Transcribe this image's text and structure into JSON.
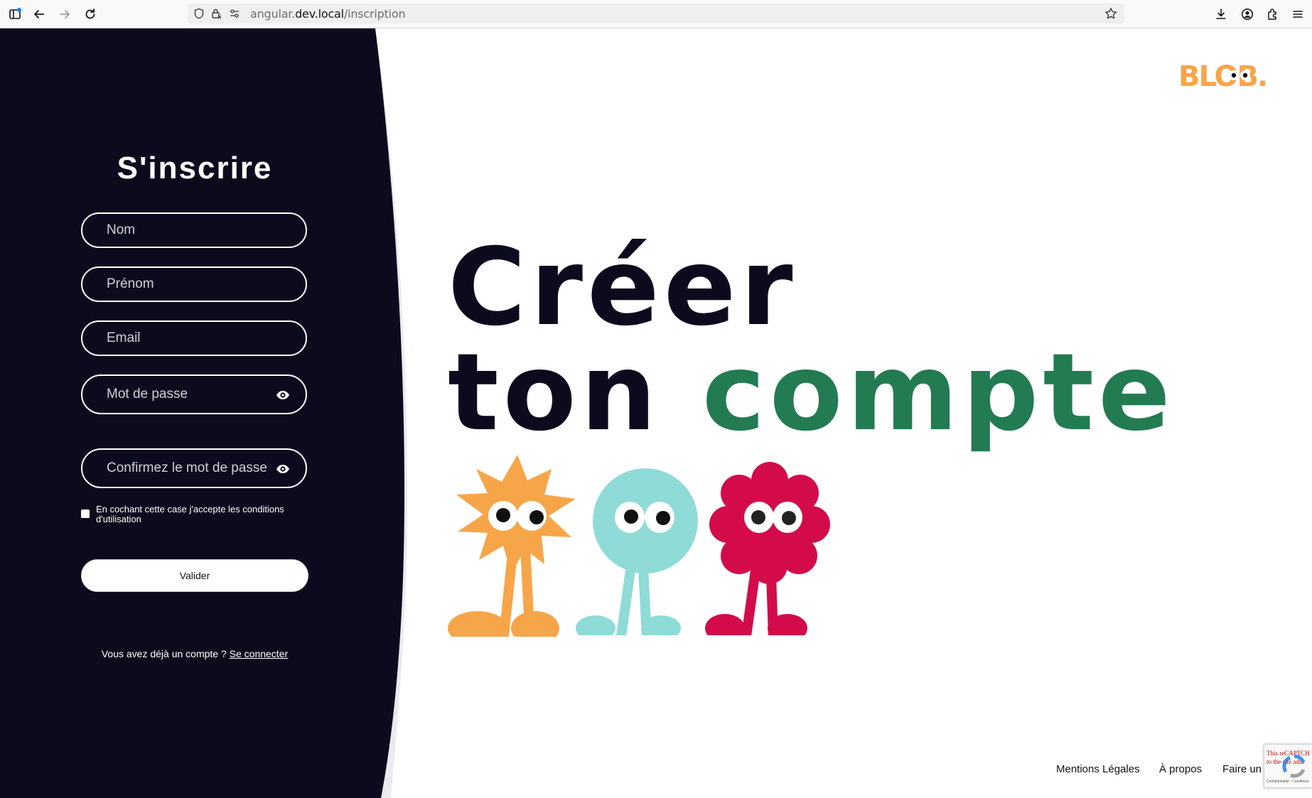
{
  "browser": {
    "url_prefix": "angular.",
    "url_host": "dev.local",
    "url_path": "/inscription"
  },
  "form": {
    "title": "S'inscrire",
    "nom_placeholder": "Nom",
    "prenom_placeholder": "Prénom",
    "email_placeholder": "Email",
    "password_placeholder": "Mot de passe",
    "confirm_placeholder": "Confirmez le mot de passe",
    "terms_text": "En cochant cette case j'accepte les conditions d'utilisation",
    "submit_label": "Valider",
    "login_prompt": "Vous avez déjà un compte ? ",
    "login_link": "Se connecter"
  },
  "hero": {
    "line1": "Créer",
    "line2_dark": "ton ",
    "line2_green": "compte"
  },
  "logo": {
    "text": "BLOB."
  },
  "footer": {
    "mentions": "Mentions Légales",
    "apropos": "À propos",
    "don": "Faire un D"
  },
  "recaptcha": {
    "warning_line1": "This reCAPTCH",
    "warning_line2": "to the site adm",
    "small_text": "Confidentialité - Conditions"
  },
  "colors": {
    "panel": "#0c0b1e",
    "green": "#237b52",
    "orange": "#f7a549",
    "cyan": "#8fdbd8",
    "magenta": "#d30b4a"
  },
  "icons": [
    "sidebar-icon",
    "back-arrow-icon",
    "forward-arrow-icon",
    "reload-icon",
    "shield-icon",
    "lock-icon",
    "site-settings-icon",
    "bookmark-star-icon",
    "download-icon",
    "account-icon",
    "extensions-icon",
    "menu-icon",
    "eye-icon"
  ]
}
